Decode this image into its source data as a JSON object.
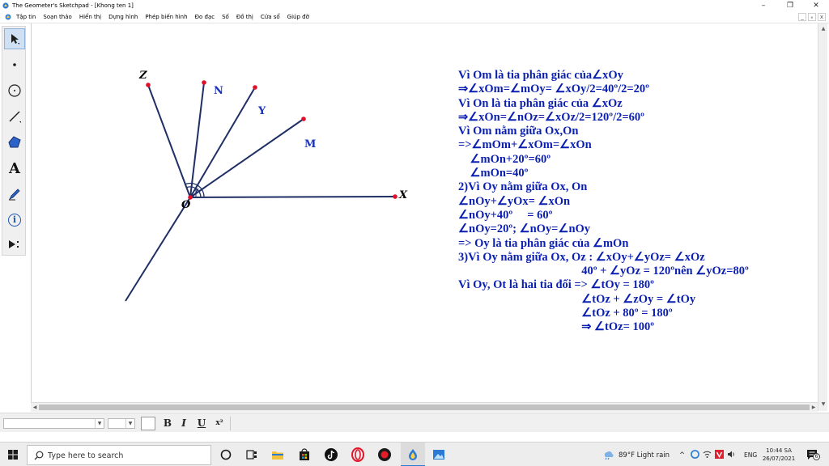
{
  "window": {
    "title": "The Geometer's Sketchpad - [Khong ten 1]",
    "controls": [
      "–",
      "❐",
      "✕"
    ]
  },
  "menubar": {
    "items": [
      "Tập tin",
      "Soạn thảo",
      "Hiển thị",
      "Dựng hình",
      "Phép biến hình",
      "Đo đạc",
      "Số",
      "Đồ thị",
      "Cửa sổ",
      "Giúp đỡ"
    ],
    "doc_controls": [
      "_",
      "ₑ",
      "x"
    ]
  },
  "toolbox": {
    "tools": [
      "arrow-select-tool",
      "point-tool",
      "compass-tool",
      "straightedge-tool",
      "polygon-tool",
      "text-tool",
      "marker-tool",
      "information-tool",
      "custom-tools"
    ],
    "text_tool_glyph": "A",
    "info_tool_glyph": "i",
    "active_tool": "arrow-select-tool"
  },
  "sketch": {
    "line_color": "#1f2f66",
    "point_color": "#e0102a",
    "labels": {
      "z": "Z",
      "n": "N",
      "y": "Y",
      "m": "M",
      "x": "X",
      "o": "O"
    }
  },
  "solution": {
    "color": "#0a1fb0",
    "lines": [
      "Vì Om là tia phân giác của∠xOy",
      "⇒∠xOm=∠mOy= ∠xOy/2=40º/2=20º",
      "Vì On là tia phân giác của ∠xOz",
      "⇒∠xOn=∠nOz=∠xOz/2=120º/2=60º",
      "Vì Om nằm giữa Ox,On",
      "=>∠mOm+∠xOm=∠xOn",
      "    ∠mOn+20º=60º",
      "    ∠mOn=40º",
      "2)Vì Oy nằm giữa Ox, On",
      "∠nOy+∠yOx= ∠xOn",
      "∠nOy+40º     = 60º",
      "∠nOy=20º; ∠nOy=∠nOy",
      "=> Oy là tia phân giác của ∠mOn",
      "3)Vì Oy nằm giữa Ox, Oz : ∠xOy+∠yOz= ∠xOz",
      "                                          40º + ∠yOz = 120ºnên ∠yOz=80º",
      "Vì Oy, Ot là hai tia đối => ∠tOy = 180º",
      "                                          ∠tOz + ∠zOy = ∠tOy",
      "                                          ∠tOz + 80º = 180º",
      "                                          ⇒ ∠tOz= 100º"
    ]
  },
  "scrollbars": {
    "up": "▲",
    "down": "▼",
    "left": "◀",
    "right": "▶"
  },
  "formatbar": {
    "bold": "B",
    "italic": "I",
    "underline": "U",
    "symbol": "x²"
  },
  "taskbar": {
    "search_placeholder": "Type here to search",
    "weather": "89°F  Light rain",
    "tray_chevron": "^",
    "language": "ENG",
    "time": "10:44 SA",
    "date": "26/07/2021",
    "notification_count": "6"
  }
}
